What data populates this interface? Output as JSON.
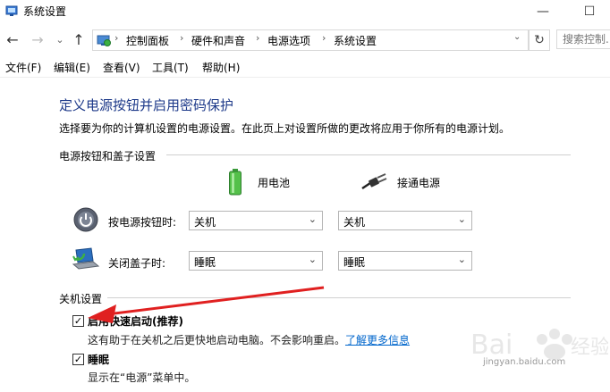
{
  "window": {
    "title": "系统设置",
    "minimize": "—",
    "maximize": "☐"
  },
  "nav": {
    "back": "←",
    "forward": "→",
    "history": "⌄",
    "up": "↑",
    "breadcrumbs": [
      "控制面板",
      "硬件和声音",
      "电源选项",
      "系统设置"
    ],
    "separator": "›",
    "dropdown": "⌄",
    "refresh": "↻",
    "search_placeholder": "搜索控制..."
  },
  "menu": [
    "文件(F)",
    "编辑(E)",
    "查看(V)",
    "工具(T)",
    "帮助(H)"
  ],
  "content": {
    "heading": "定义电源按钮并启用密码保护",
    "description": "选择要为你的计算机设置的电源设置。在此页上对设置所做的更改将应用于你所有的电源计划。",
    "section1_title": "电源按钮和盖子设置",
    "battery_label": "用电池",
    "plugged_label": "接通电源",
    "rows": [
      {
        "label": "按电源按钮时:",
        "battery": "关机",
        "plugged": "关机",
        "icon": "power-button-icon"
      },
      {
        "label": "关闭盖子时:",
        "battery": "睡眠",
        "plugged": "睡眠",
        "icon": "laptop-lid-icon"
      }
    ],
    "section2_title": "关机设置",
    "fast_startup": {
      "label": "启用快速启动(推荐)",
      "checked": true,
      "desc": "这有助于在关机之后更快地启动电脑。不会影响重启。",
      "link": "了解更多信息"
    },
    "sleep": {
      "label": "睡眠",
      "checked": true,
      "desc": "显示在“电源”菜单中。"
    }
  },
  "watermark": {
    "text": "jingyan.baidu.com"
  },
  "colors": {
    "heading": "#1e3a8a",
    "link": "#0066cc",
    "arrow": "#e02020"
  }
}
